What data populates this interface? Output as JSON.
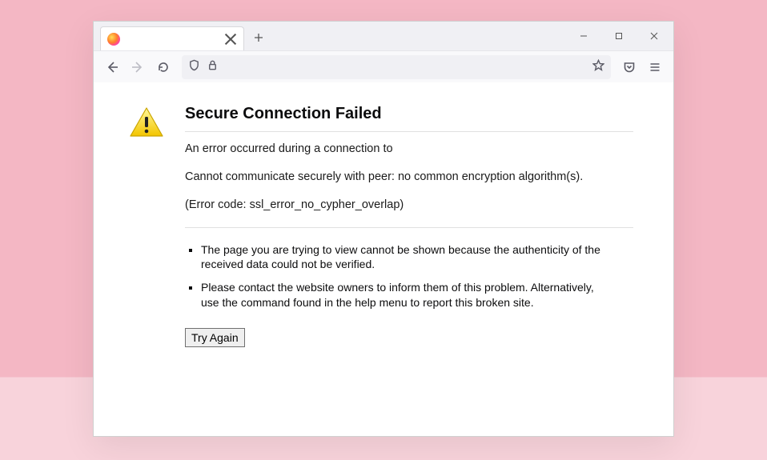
{
  "window": {
    "tab_title": ""
  },
  "error": {
    "title": "Secure Connection Failed",
    "line1": "An error occurred during a connection to",
    "line2": "Cannot communicate securely with peer: no common encryption algorithm(s).",
    "line3": "(Error code: ssl_error_no_cypher_overlap)",
    "bullets": [
      "The page you are trying to view cannot be shown because the authenticity of the received data could not be verified.",
      "Please contact the website owners to inform them of this problem. Alternatively, use the command found in the help menu to report this broken site."
    ],
    "retry_label": "Try Again"
  }
}
